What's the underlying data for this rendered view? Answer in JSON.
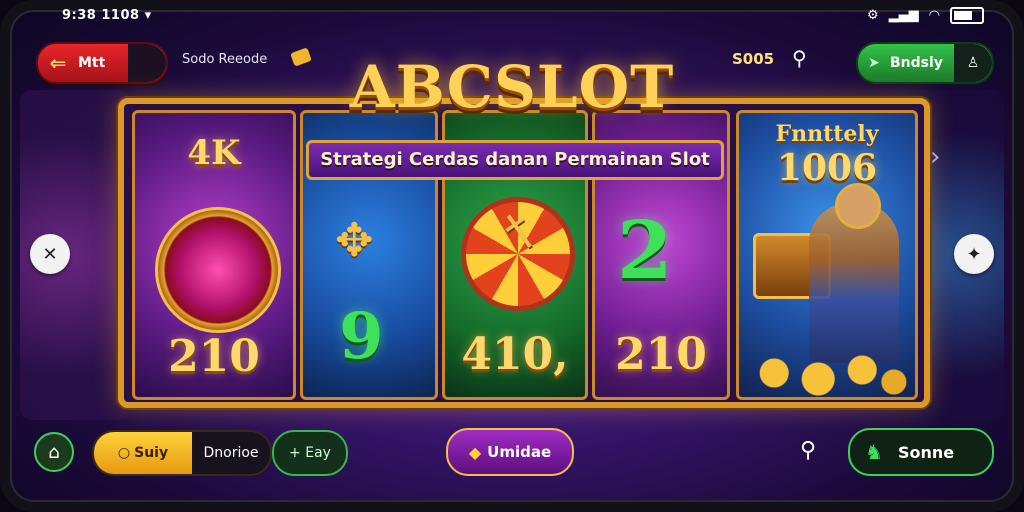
{
  "status_bar": {
    "time": "9:38 1108"
  },
  "top_bar": {
    "back_label": "Mtt",
    "center_label": "Sodo Reeode",
    "score": "S005",
    "friends_label": "Bndsly"
  },
  "logo": {
    "title": "ABCSLOT",
    "subtitle": "Strategi Cerdas danan Permainan Slot"
  },
  "reels": {
    "r1": {
      "top": "4K",
      "bottom": "210"
    },
    "r2": {
      "symbol": "9"
    },
    "r3": {
      "bottom": "410,"
    },
    "r4": {
      "symbol": "2",
      "bottom": "210"
    },
    "r5": {
      "label": "Fnnttely",
      "number": "1006"
    }
  },
  "bottom_bar": {
    "left_pill_a": "Suiy",
    "left_pill_b": "Dnorioe",
    "green_pill": "+ Eay",
    "center_pill": "Umidae",
    "share_label": "Sonne"
  }
}
